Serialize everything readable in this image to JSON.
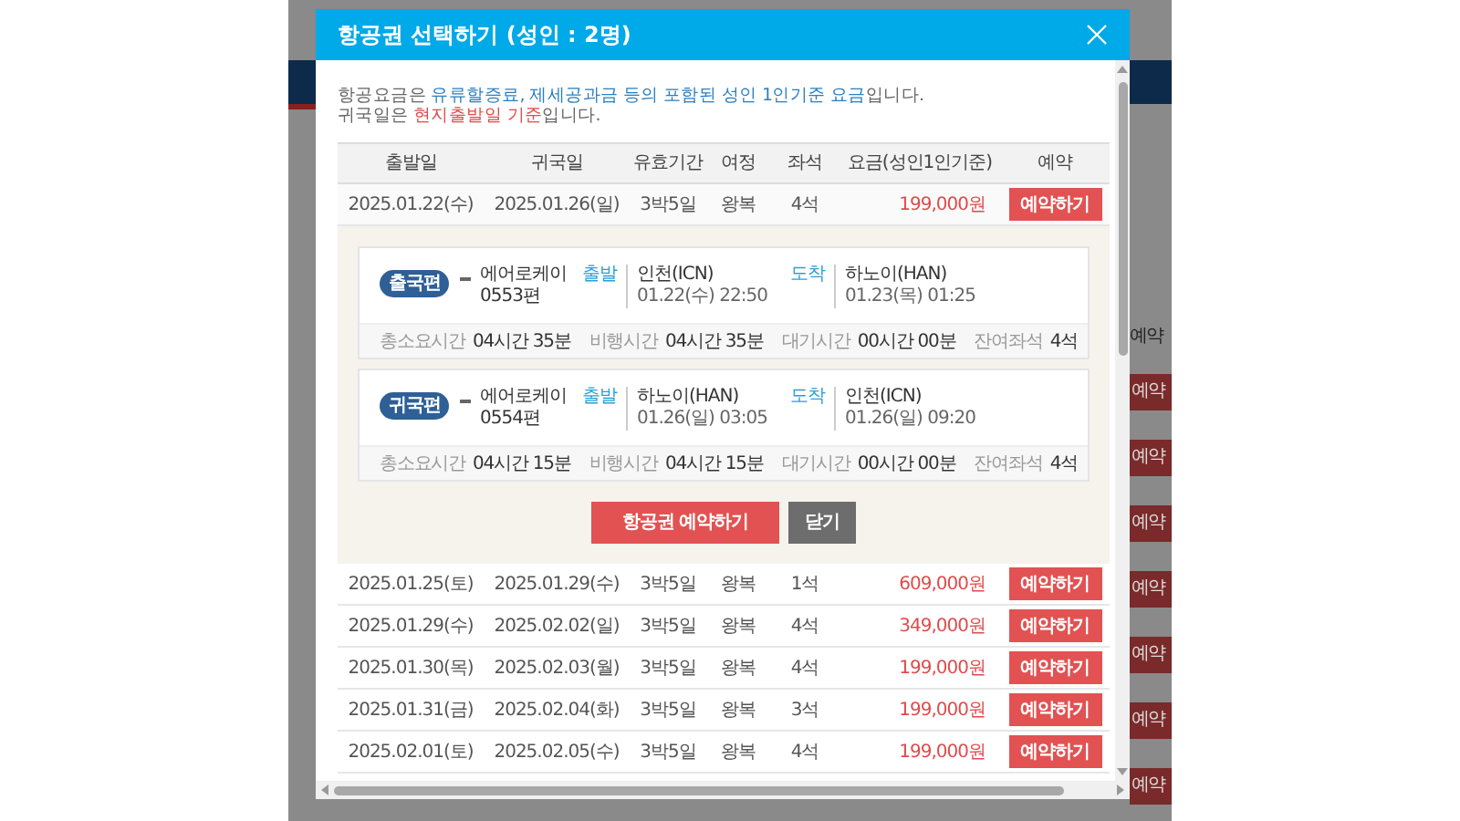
{
  "background": {
    "reserve_buttons": [
      "예약",
      "예약",
      "예약",
      "예약",
      "예약",
      "예약",
      "예약"
    ],
    "column_heading": "예약"
  },
  "dialog": {
    "title": "항공권 선택하기 (성인 : 2명)",
    "notice": [
      [
        {
          "text": "항공요금은 ",
          "color": "#666666"
        },
        {
          "text": "유류할증료, 제세공과금 등의 포함된 성인 1인기준 요금",
          "color": "#2a7fc0"
        },
        {
          "text": "입니다.",
          "color": "#666666"
        }
      ],
      [
        {
          "text": "귀국일은 ",
          "color": "#666666"
        },
        {
          "text": "현지출발일 기준",
          "color": "#e04b4b"
        },
        {
          "text": "입니다.",
          "color": "#666666"
        }
      ]
    ],
    "table": {
      "columns": [
        "출발일",
        "귀국일",
        "유효기간",
        "여정",
        "좌석",
        "요금(성인1인기준)",
        "예약"
      ],
      "rows": [
        {
          "depart": "2025.01.22(수)",
          "return": "2025.01.26(일)",
          "period": "3박5일",
          "trip": "왕복",
          "seats": "4석",
          "fare": "199,000원",
          "button": "예약하기",
          "details": {
            "flights": [
              {
                "badge": "출국편",
                "airline": "에어로케이",
                "flight_no": "0553편",
                "depart_label": "출발",
                "depart_place": "인천(ICN)",
                "depart_time": "01.22(수) 22:50",
                "arrive_label": "도착",
                "arrive_place": "하노이(HAN)",
                "arrive_time": "01.23(목) 01:25",
                "stats": [
                  {
                    "label": "총소요시간",
                    "value": "04시간 35분"
                  },
                  {
                    "label": "비행시간",
                    "value": "04시간 35분"
                  },
                  {
                    "label": "대기시간",
                    "value": "00시간 00분"
                  },
                  {
                    "label": "잔여좌석",
                    "value": "4석"
                  }
                ]
              },
              {
                "badge": "귀국편",
                "airline": "에어로케이",
                "flight_no": "0554편",
                "depart_label": "출발",
                "depart_place": "하노이(HAN)",
                "depart_time": "01.26(일) 03:05",
                "arrive_label": "도착",
                "arrive_place": "인천(ICN)",
                "arrive_time": "01.26(일) 09:20",
                "stats": [
                  {
                    "label": "총소요시간",
                    "value": "04시간 15분"
                  },
                  {
                    "label": "비행시간",
                    "value": "04시간 15분"
                  },
                  {
                    "label": "대기시간",
                    "value": "00시간 00분"
                  },
                  {
                    "label": "잔여좌석",
                    "value": "4석"
                  }
                ]
              }
            ],
            "actions": [
              {
                "label": "항공권 예약하기",
                "kind": "primary"
              },
              {
                "label": "닫기",
                "kind": "secondary"
              }
            ]
          }
        },
        {
          "depart": "2025.01.25(토)",
          "return": "2025.01.29(수)",
          "period": "3박5일",
          "trip": "왕복",
          "seats": "1석",
          "fare": "609,000원",
          "button": "예약하기"
        },
        {
          "depart": "2025.01.29(수)",
          "return": "2025.02.02(일)",
          "period": "3박5일",
          "trip": "왕복",
          "seats": "4석",
          "fare": "349,000원",
          "button": "예약하기"
        },
        {
          "depart": "2025.01.30(목)",
          "return": "2025.02.03(월)",
          "period": "3박5일",
          "trip": "왕복",
          "seats": "4석",
          "fare": "199,000원",
          "button": "예약하기"
        },
        {
          "depart": "2025.01.31(금)",
          "return": "2025.02.04(화)",
          "period": "3박5일",
          "trip": "왕복",
          "seats": "3석",
          "fare": "199,000원",
          "button": "예약하기"
        },
        {
          "depart": "2025.02.01(토)",
          "return": "2025.02.05(수)",
          "period": "3박5일",
          "trip": "왕복",
          "seats": "4석",
          "fare": "199,000원",
          "button": "예약하기"
        }
      ]
    }
  }
}
